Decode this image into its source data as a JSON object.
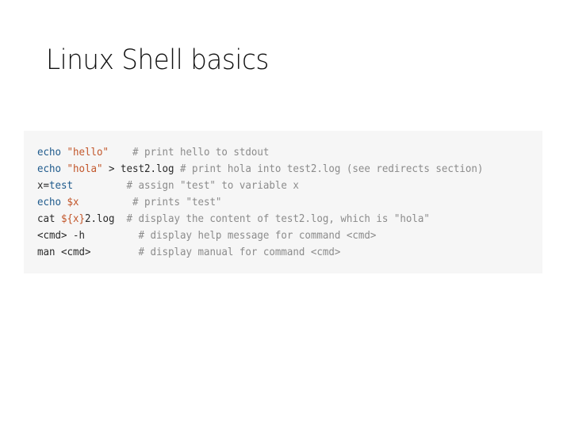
{
  "slide": {
    "title": "Linux Shell basics"
  },
  "code": {
    "language": "bash",
    "lines": [
      {
        "tokens": [
          {
            "type": "kw",
            "text": "echo"
          },
          {
            "type": "plain",
            "text": " "
          },
          {
            "type": "str",
            "text": "\"hello\""
          },
          {
            "type": "plain",
            "text": "    "
          },
          {
            "type": "cmt",
            "text": "# print hello to stdout"
          }
        ]
      },
      {
        "tokens": [
          {
            "type": "kw",
            "text": "echo"
          },
          {
            "type": "plain",
            "text": " "
          },
          {
            "type": "str",
            "text": "\"hola\""
          },
          {
            "type": "plain",
            "text": " > test2.log "
          },
          {
            "type": "cmt",
            "text": "# print hola into test2.log (see redirects section)"
          }
        ]
      },
      {
        "tokens": [
          {
            "type": "assign-name",
            "text": "x="
          },
          {
            "type": "assign-val",
            "text": "test"
          },
          {
            "type": "plain",
            "text": "         "
          },
          {
            "type": "cmt",
            "text": "# assign \"test\" to variable x"
          }
        ]
      },
      {
        "tokens": [
          {
            "type": "kw",
            "text": "echo"
          },
          {
            "type": "plain",
            "text": " "
          },
          {
            "type": "var",
            "text": "$x"
          },
          {
            "type": "plain",
            "text": "         "
          },
          {
            "type": "cmt",
            "text": "# prints \"test\""
          }
        ]
      },
      {
        "tokens": [
          {
            "type": "plain",
            "text": "cat "
          },
          {
            "type": "var",
            "text": "${x}"
          },
          {
            "type": "plain",
            "text": "2.log  "
          },
          {
            "type": "cmt",
            "text": "# display the content of test2.log, which is \"hola\""
          }
        ]
      },
      {
        "tokens": [
          {
            "type": "plain",
            "text": "<cmd> -h         "
          },
          {
            "type": "cmt",
            "text": "# display help message for command <cmd>"
          }
        ]
      },
      {
        "tokens": [
          {
            "type": "plain",
            "text": "man <cmd>        "
          },
          {
            "type": "cmt",
            "text": "# display manual for command <cmd>"
          }
        ]
      }
    ]
  }
}
